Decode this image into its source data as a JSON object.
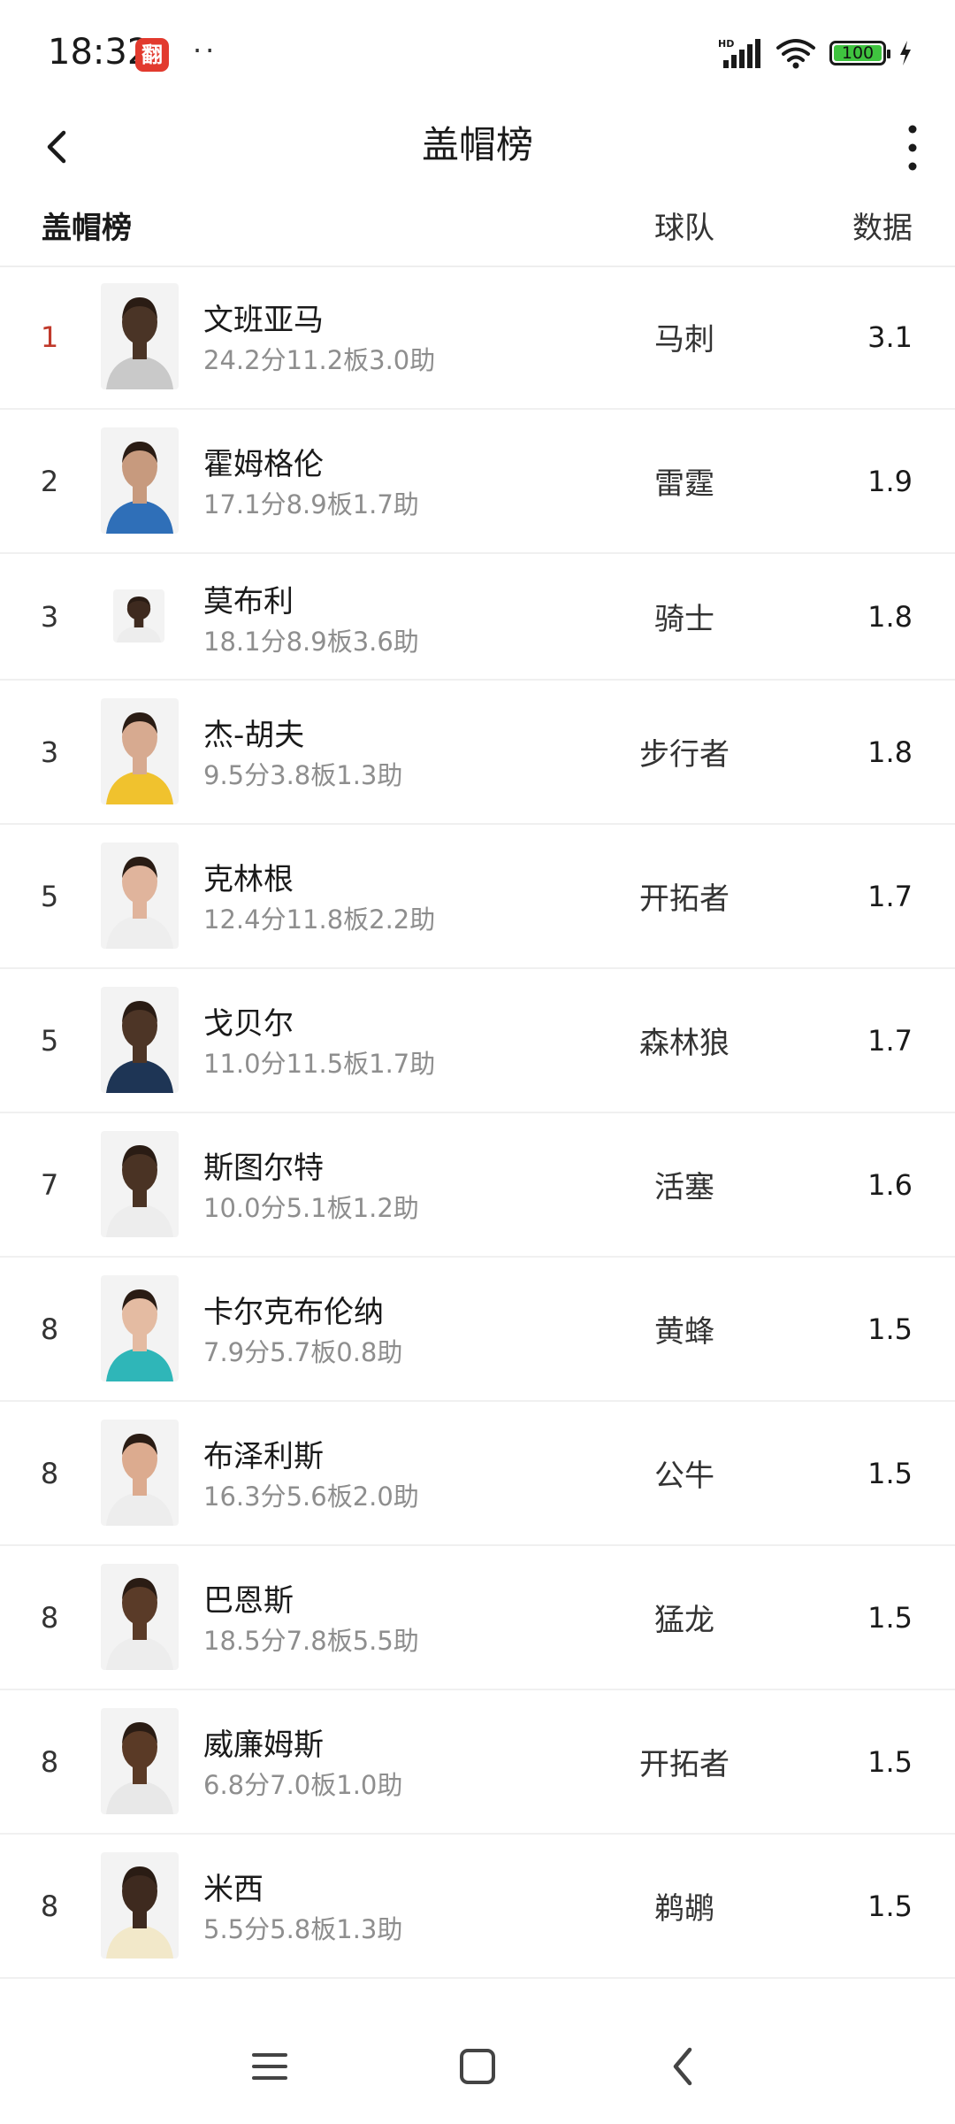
{
  "status_bar": {
    "time": "18:32",
    "app_icon_glyph": "翻",
    "dots": "··",
    "battery_level": "100",
    "signal_label": "HD",
    "icons": [
      "signal-icon",
      "wifi-icon",
      "battery-icon",
      "charging-icon"
    ]
  },
  "header": {
    "title": "盖帽榜",
    "back_icon": "chevron-left-icon",
    "more_icon": "more-vertical-icon"
  },
  "columns": {
    "title": "盖帽榜",
    "team": "球队",
    "data": "数据"
  },
  "players": [
    {
      "rank": "1",
      "name": "文班亚马",
      "stats": "24.2分11.2板3.0助",
      "team": "马刺",
      "value": "3.1",
      "jersey": "#c9c9c9",
      "skin": "#4a3426"
    },
    {
      "rank": "2",
      "name": "霍姆格伦",
      "stats": "17.1分8.9板1.7助",
      "team": "雷霆",
      "value": "1.9",
      "jersey": "#2f6fb8",
      "skin": "#c79a7e"
    },
    {
      "rank": "3",
      "name": "莫布利",
      "stats": "18.1分8.9板3.6助",
      "team": "骑士",
      "value": "1.8",
      "jersey": "#ededed",
      "skin": "#3e2a1f"
    },
    {
      "rank": "3",
      "name": "杰-胡夫",
      "stats": "9.5分3.8板1.3助",
      "team": "步行者",
      "value": "1.8",
      "jersey": "#f0c22e",
      "skin": "#d7aa90"
    },
    {
      "rank": "5",
      "name": "克林根",
      "stats": "12.4分11.8板2.2助",
      "team": "开拓者",
      "value": "1.7",
      "jersey": "#eeeeee",
      "skin": "#e0b49c"
    },
    {
      "rank": "5",
      "name": "戈贝尔",
      "stats": "11.0分11.5板1.7助",
      "team": "森林狼",
      "value": "1.7",
      "jersey": "#1e3555",
      "skin": "#4d3526"
    },
    {
      "rank": "7",
      "name": "斯图尔特",
      "stats": "10.0分5.1板1.2助",
      "team": "活塞",
      "value": "1.6",
      "jersey": "#ededed",
      "skin": "#4a3324"
    },
    {
      "rank": "8",
      "name": "卡尔克布伦纳",
      "stats": "7.9分5.7板0.8助",
      "team": "黄蜂",
      "value": "1.5",
      "jersey": "#2fb6b8",
      "skin": "#e4bba2"
    },
    {
      "rank": "8",
      "name": "布泽利斯",
      "stats": "16.3分5.6板2.0助",
      "team": "公牛",
      "value": "1.5",
      "jersey": "#ededed",
      "skin": "#dcab8f"
    },
    {
      "rank": "8",
      "name": "巴恩斯",
      "stats": "18.5分7.8板5.5助",
      "team": "猛龙",
      "value": "1.5",
      "jersey": "#ededed",
      "skin": "#5a3b28"
    },
    {
      "rank": "8",
      "name": "威廉姆斯",
      "stats": "6.8分7.0板1.0助",
      "team": "开拓者",
      "value": "1.5",
      "jersey": "#e8e8e8",
      "skin": "#5a3a26"
    },
    {
      "rank": "8",
      "name": "米西",
      "stats": "5.5分5.8板1.3助",
      "team": "鹈鹕",
      "value": "1.5",
      "jersey": "#f2e8c9",
      "skin": "#3e2a1f"
    }
  ],
  "nav_bar": {
    "icons": [
      "menu-icon",
      "home-square-icon",
      "back-triangle-icon"
    ]
  }
}
